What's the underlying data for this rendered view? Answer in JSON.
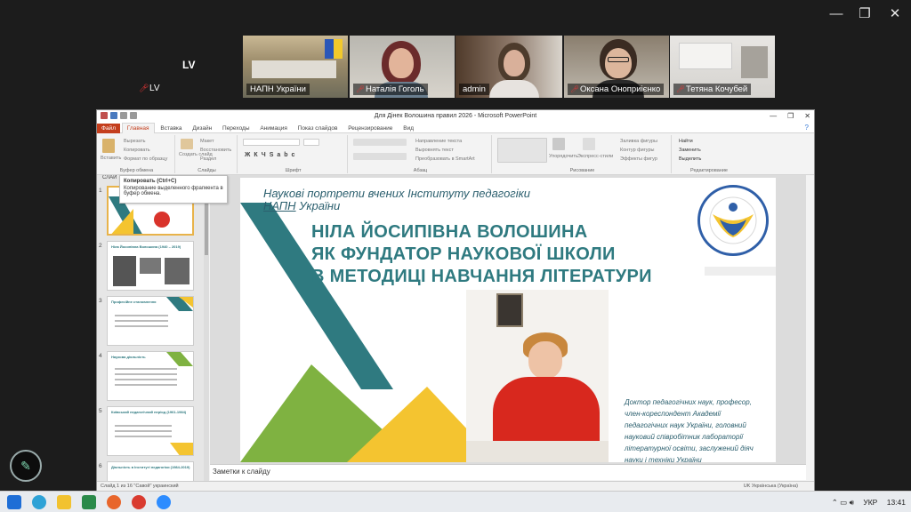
{
  "user": {
    "top_label": "LV",
    "self_name": "LV"
  },
  "window_controls": {
    "minimize": "—",
    "restore": "❐",
    "close": "✕"
  },
  "participants": [
    {
      "name": "НАПН України",
      "muted": false,
      "active": false
    },
    {
      "name": "Наталія Гоголь",
      "muted": true,
      "active": false
    },
    {
      "name": "admin",
      "muted": false,
      "active": true
    },
    {
      "name": "Оксана Оноприієнко",
      "muted": true,
      "active": false
    },
    {
      "name": "Тетяна Кочубей",
      "muted": true,
      "active": false
    }
  ],
  "ppt": {
    "title": "Для Дінек Волошина правил  2026  -  Microsoft PowerPoint",
    "tabs": [
      "Файл",
      "Главная",
      "Вставка",
      "Дизайн",
      "Переходы",
      "Анимация",
      "Показ слайдов",
      "Рецензирование",
      "Вид"
    ],
    "ribbon_groups": [
      "Буфер обмена",
      "Слайды",
      "Шрифт",
      "Абзац",
      "Рисование",
      "Редактирование"
    ],
    "ribbon_items": {
      "paste": "Вставить",
      "cut": "Вырезать",
      "copy": "Копировать",
      "format": "Формат по образцу",
      "create_slide": "Создать слайд",
      "layout": "Макет",
      "reset": "Восстановить",
      "section": "Раздел",
      "text_direction": "Направление текста",
      "align_text": "Выровнять текст",
      "smartart": "Преобразовать в SmartArt",
      "arrange": "Упорядочить",
      "quick_styles": "Экспресс-стили",
      "shape_fill": "Заливка фигуры",
      "shape_outline": "Контур фигуры",
      "shape_effects": "Эффекты фигур",
      "find": "Найти",
      "replace": "Заменить",
      "select": "Выделить"
    },
    "tooltip": {
      "title": "Копировать (Ctrl+C)",
      "body": "Копирование выделенного фрагмента в буфер обмена."
    },
    "panel_tab": "СЛАЙ",
    "notes_placeholder": "Заметки к слайду",
    "status_left": "Слайд 1 из 16   \"Савой\"   украинский",
    "status_right": "UK Українська (Україна)"
  },
  "slide": {
    "pre_line1": "Наукові портрети вчених Інституту педагогіки",
    "pre_line2_ul": "НАПН",
    "pre_line2_rest": " України",
    "title_lines": [
      "НІЛА ЙОСИПІВНА ВОЛОШИНА",
      "ЯК ФУНДАТОР НАУКОВОЇ ШКОЛИ",
      "В МЕТОДИЦІ НАВЧАННЯ ЛІТЕРАТУРИ"
    ],
    "description_lines": [
      "Доктор педагогічних наук, професор,",
      "член-кореспондент               Академії",
      "педагогічних наук України, головний",
      "науковий співробітник лабораторії",
      "літературної освіти, заслужений діяч",
      "науки і техніки України"
    ],
    "logo_text": "INSTITUTE OF PEDAGOGY OF THE NAES OF UKRAINE"
  },
  "thumbnails": [
    {
      "num": "1",
      "title": "Наукові портрети вчених Інституту педагогіки НАПН України"
    },
    {
      "num": "2",
      "title": "Ніла Йосипівна Волошина (1940 – 2019)"
    },
    {
      "num": "3",
      "title": "Професійне становлення"
    },
    {
      "num": "4",
      "title": "Наукова діяльність"
    },
    {
      "num": "5",
      "title": "Київський педагогічний період (1961-1984)"
    },
    {
      "num": "6",
      "title": "Діяльність в Інституті педагогіки (1984-2019)"
    }
  ],
  "taskbar": {
    "lang": "УКР",
    "time": "13:41"
  },
  "colors": {
    "teal": "#2f7a80",
    "yellow": "#f4c430",
    "green": "#7fb241",
    "red": "#d9332b",
    "accent": "#c43e1c"
  }
}
